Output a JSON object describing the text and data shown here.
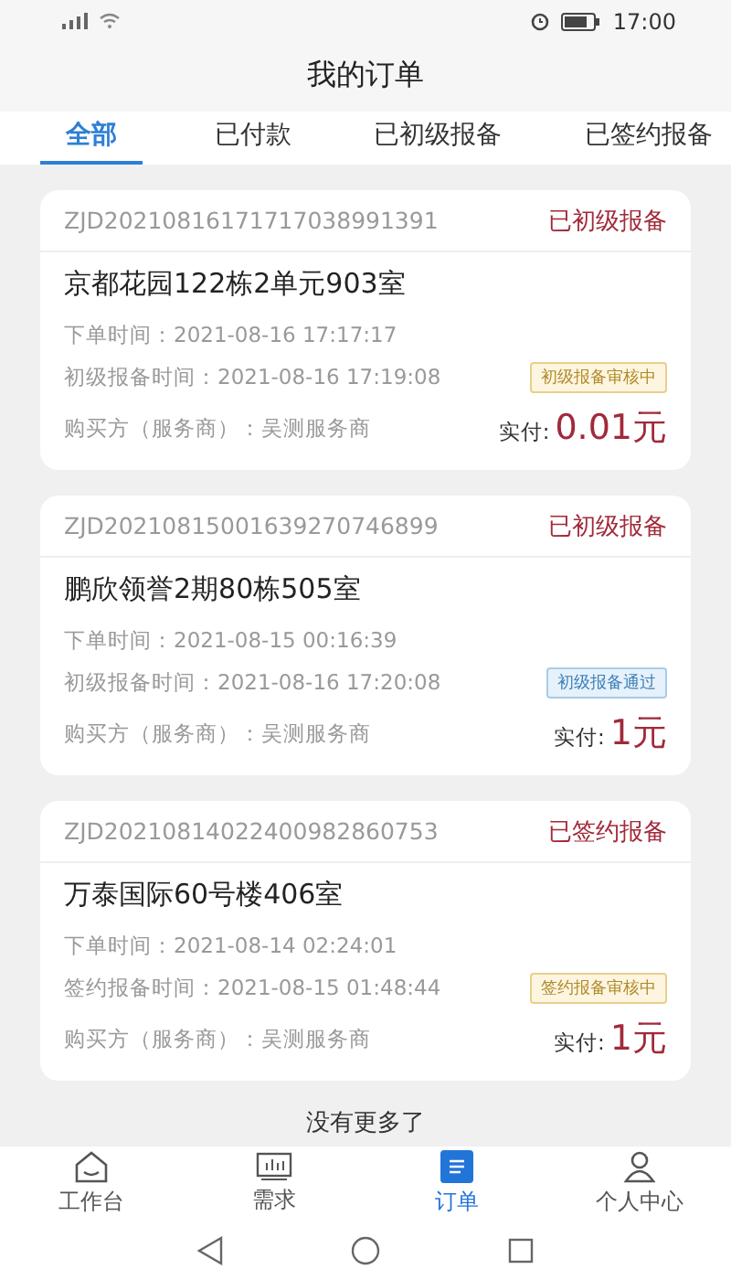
{
  "status_bar": {
    "time": "17:00"
  },
  "title": "我的订单",
  "tabs": [
    {
      "label": "全部",
      "selected": true
    },
    {
      "label": "已付款",
      "selected": false
    },
    {
      "label": "已初级报备",
      "selected": false
    },
    {
      "label": "已签约报备",
      "selected": false
    }
  ],
  "orders": [
    {
      "order_no": "ZJD20210816171717038991391",
      "status": "已初级报备",
      "address": "京都花园122栋2单元903室",
      "order_time_label": "下单时间：",
      "order_time": "2021-08-16 17:17:17",
      "report_time_label": "初级报备时间：",
      "report_time": "2021-08-16 17:19:08",
      "buyer_label": "购买方（服务商）：",
      "buyer": "吴测服务商",
      "badge": {
        "text": "初级报备审核中",
        "kind": "pending"
      },
      "paid_label": "实付:",
      "amount": "0.01元"
    },
    {
      "order_no": "ZJD20210815001639270746899",
      "status": "已初级报备",
      "address": "鹏欣领誉2期80栋505室",
      "order_time_label": "下单时间：",
      "order_time": "2021-08-15 00:16:39",
      "report_time_label": "初级报备时间：",
      "report_time": "2021-08-16 17:20:08",
      "buyer_label": "购买方（服务商）：",
      "buyer": "吴测服务商",
      "badge": {
        "text": "初级报备通过",
        "kind": "passed"
      },
      "paid_label": "实付:",
      "amount": "1元"
    },
    {
      "order_no": "ZJD20210814022400982860753",
      "status": "已签约报备",
      "address": "万泰国际60号楼406室",
      "order_time_label": "下单时间：",
      "order_time": "2021-08-14 02:24:01",
      "report_time_label": "签约报备时间：",
      "report_time": "2021-08-15 01:48:44",
      "buyer_label": "购买方（服务商）：",
      "buyer": "吴测服务商",
      "badge": {
        "text": "签约报备审核中",
        "kind": "pending"
      },
      "paid_label": "实付:",
      "amount": "1元"
    }
  ],
  "footer_note": "没有更多了",
  "bottom_nav": [
    {
      "label": "工作台",
      "kind": "home",
      "selected": false
    },
    {
      "label": "需求",
      "kind": "chart",
      "selected": false
    },
    {
      "label": "订单",
      "kind": "list",
      "selected": true
    },
    {
      "label": "个人中心",
      "kind": "person",
      "selected": false
    }
  ]
}
